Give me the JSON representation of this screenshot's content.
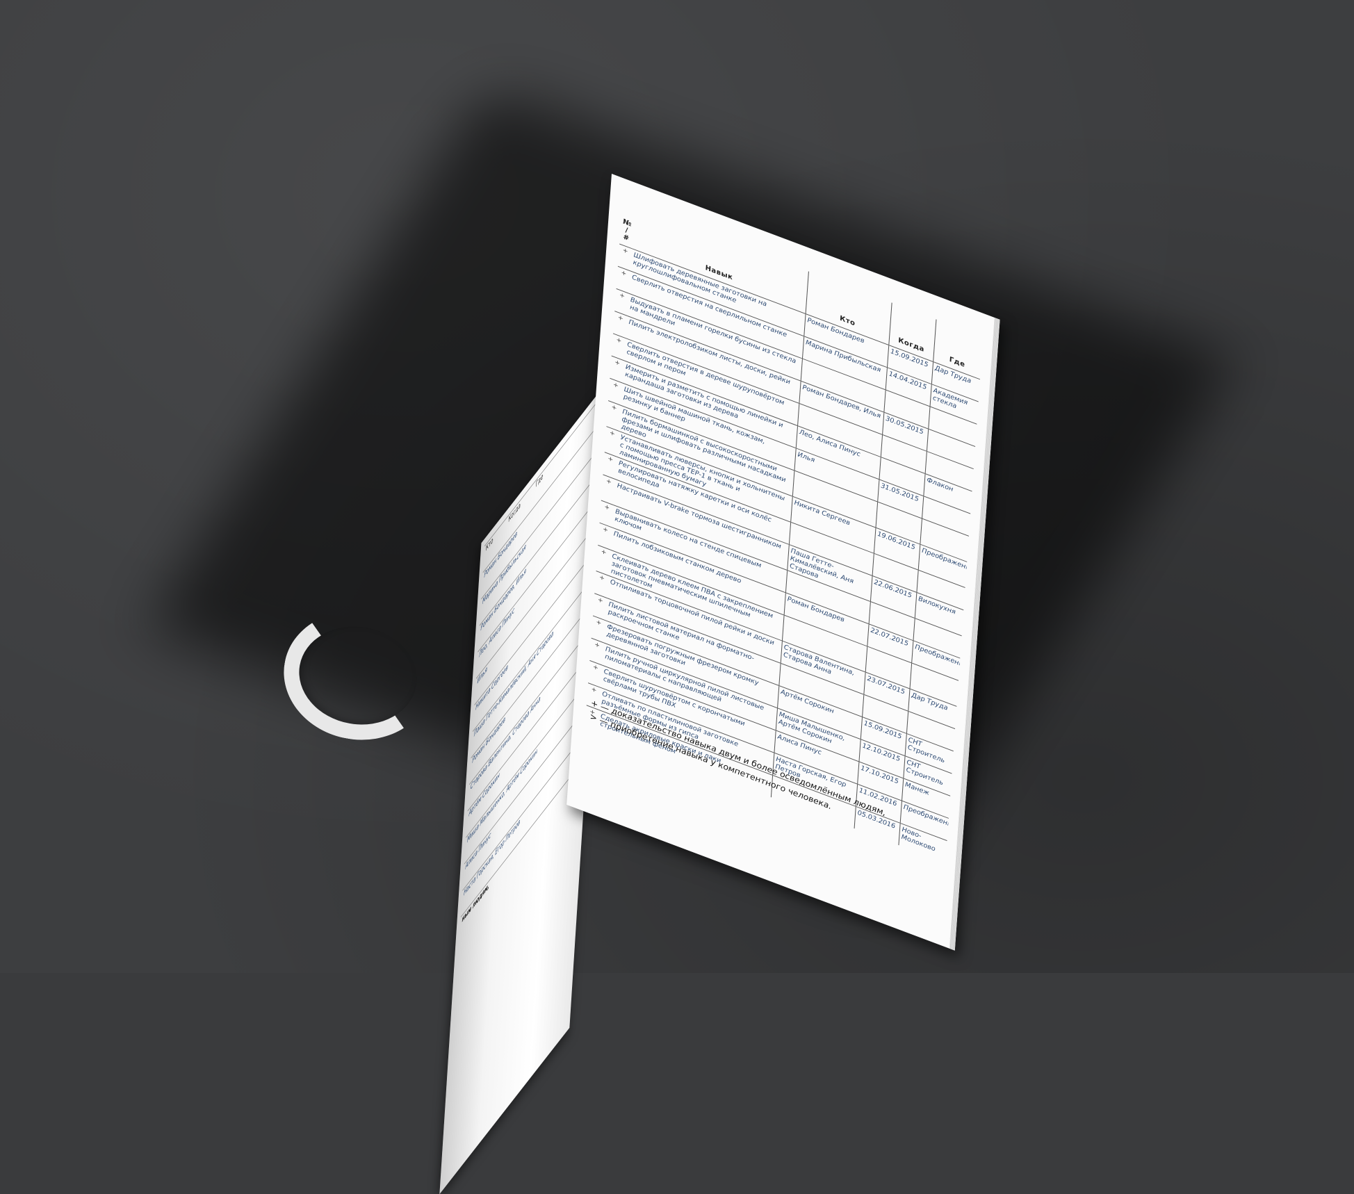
{
  "headers": {
    "mark": "№ / #",
    "skill": "Навык",
    "who": "Кто",
    "when": "Когда",
    "where": "Где"
  },
  "rows": [
    {
      "mark": "+",
      "skill": "Шлифовать деревянные заготовки на круглошлифовальном станке",
      "who": "Роман Бондарев",
      "when": "15.09.2015",
      "where": "Дар Труда"
    },
    {
      "mark": "+",
      "skill": "Сверлить отверстия на сверлильном станке",
      "who": "Марина Прибыльская",
      "when": "14.04.2015",
      "where": "Академия стекла"
    },
    {
      "mark": "+",
      "skill": "Выдувать в пламени горелки бусины из стекла на мандрели",
      "who": "",
      "when": "",
      "where": ""
    },
    {
      "mark": "+",
      "skill": "Пилить электролобзиком листы, доски, рейки",
      "who": "Роман Бондарев, Илья",
      "when": "30.05.2015",
      "where": ""
    },
    {
      "mark": "+",
      "skill": "Сверлить отверстия в дереве шуруповёртом сверлом и пером",
      "who": "",
      "when": "",
      "where": ""
    },
    {
      "mark": "+",
      "skill": "Измерить и разметить с помощью линейки и карандаша заготовки из дерева",
      "who": "Лео, Алиса Пинус",
      "when": "",
      "where": "Флакон"
    },
    {
      "mark": "+",
      "skill": "Шить швейной машиной ткань, кожзам, резинку и баннер",
      "who": "Илья",
      "when": "31.05.2015",
      "where": ""
    },
    {
      "mark": "+",
      "skill": "Пилить бормашинкой с высокоскоростными фрезами и шлифовать различными насадками дерево",
      "who": "",
      "when": "",
      "where": ""
    },
    {
      "mark": "+",
      "skill": "Устанавливать люверсы, кнопки и хольнитены с помощью пресса ТЕР-1 в ткань и ламинированную бумагу",
      "who": "Никита Сергеев",
      "when": "19.06.2015",
      "where": "Преображенка"
    },
    {
      "mark": "+",
      "skill": "Регулировать натяжку каретки и оси колёс велосипеда",
      "who": "",
      "when": "",
      "where": ""
    },
    {
      "mark": "+",
      "skill": "Настраивать V-brake тормоза шестигранником",
      "who": "Паша Гетте-Кималёвский, Аня Старова",
      "when": "22.06.2015",
      "where": "Вилокухня"
    },
    {
      "mark": "+",
      "skill": "Выравнивать колесо на стенде спицевым ключом",
      "who": "",
      "when": "",
      "where": ""
    },
    {
      "mark": "+",
      "skill": "Пилить лобзиковым станком дерево",
      "who": "Роман Бондарев",
      "when": "22.07.2015",
      "where": "Преображенка"
    },
    {
      "mark": "+",
      "skill": "Склеивать дерево клеем ПВА с закреплением заготовок пневматическим шпилечным пистолетом",
      "who": "",
      "when": "",
      "where": ""
    },
    {
      "mark": "+",
      "skill": "Отпиливать торцовочной пилой рейки и доски",
      "who": "Старова Валентина, Старова Анна",
      "when": "23.07.2015",
      "where": "Дар Труда"
    },
    {
      "mark": "+",
      "skill": "Пилить листовой материал на форматно-раскроечном станке",
      "who": "",
      "when": "",
      "where": ""
    },
    {
      "mark": "+",
      "skill": "Фрезеровать погружным фрезером кромку деревянной заготовки",
      "who": "Артём Сорокин",
      "when": "15.09.2015",
      "where": "СНТ Строитель"
    },
    {
      "mark": "+",
      "skill": "Пилить ручной циркулярной пилой листовые пиломатериалы с направляющей",
      "who": "Миша Малышенко, Артём Сорокин",
      "when": "12.10.2015",
      "where": "СНТ Строитель"
    },
    {
      "mark": "+",
      "skill": "Сверлить шуруповёртом с корончатыми свёрлами трубы ПВХ",
      "who": "Алиса Пинус",
      "when": "17.10.2015",
      "where": "Манеж"
    },
    {
      "mark": "+",
      "skill": "Отливать по пластилиновой заготовке разъёмные формы из гипса",
      "who": "Наста Горская, Егор Петров",
      "when": "11.02.2016",
      "where": "Преображенка"
    },
    {
      "mark": "+",
      "skill": "Сделать акриловые краски и лаки строительным феном",
      "who": "",
      "when": "05.03.2016",
      "where": "Ново-Молоково"
    }
  ],
  "legend": {
    "plus": "+ — доказательство навыка двум и более осведомлённым людям,",
    "gt": "> — приобретение навыка у компетентного человека."
  },
  "left_page": {
    "headers": [
      "Кто",
      "Когда",
      "Где"
    ],
    "names": [
      "Роман Бондарев",
      "Марина Прибыльская",
      "Роман Бондарев, Илья",
      "Лео, Алиса Пинус",
      "Илья",
      "Никита Сергеев",
      "Паша Гетте-Кималёвский, Аня Старова",
      "Роман Бондарев",
      "Старова Валентина, Старова Анна",
      "Артём Сорокин",
      "Миша Малышенко, Артём Сорокин",
      "Алиса Пинус",
      "Наста Горская, Егор Петров"
    ],
    "footer": "ным людям,"
  }
}
